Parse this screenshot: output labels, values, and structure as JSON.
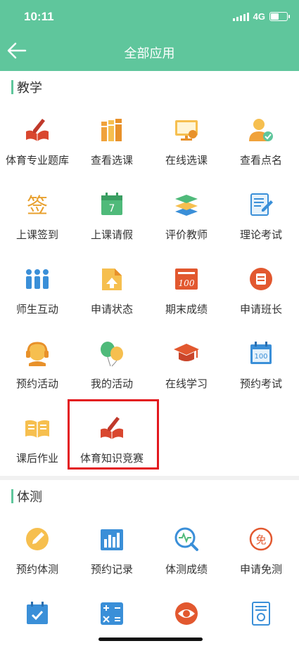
{
  "status": {
    "time": "10:11",
    "network": "4G"
  },
  "header": {
    "title": "全部应用"
  },
  "sections": [
    {
      "name": "教学",
      "items": [
        {
          "label": "体育专业题库",
          "icon": "book-pen-icon"
        },
        {
          "label": "查看选课",
          "icon": "books-icon"
        },
        {
          "label": "在线选课",
          "icon": "screen-icon"
        },
        {
          "label": "查看点名",
          "icon": "user-check-icon"
        },
        {
          "label": "上课签到",
          "icon": "sign-icon"
        },
        {
          "label": "上课请假",
          "icon": "calendar-icon"
        },
        {
          "label": "评价教师",
          "icon": "layers-icon"
        },
        {
          "label": "理论考试",
          "icon": "document-edit-icon"
        },
        {
          "label": "师生互动",
          "icon": "people-icon"
        },
        {
          "label": "申请状态",
          "icon": "folder-upload-icon"
        },
        {
          "label": "期末成绩",
          "icon": "score-paper-icon"
        },
        {
          "label": "申请班长",
          "icon": "circle-list-icon"
        },
        {
          "label": "预约活动",
          "icon": "headset-icon"
        },
        {
          "label": "我的活动",
          "icon": "balloons-icon"
        },
        {
          "label": "在线学习",
          "icon": "graduation-cap-icon"
        },
        {
          "label": "预约考试",
          "icon": "calendar-100-icon"
        },
        {
          "label": "课后作业",
          "icon": "open-book-icon"
        },
        {
          "label": "体育知识竞赛",
          "icon": "book-pen-icon"
        }
      ]
    },
    {
      "name": "体测",
      "items": [
        {
          "label": "预约体测",
          "icon": "circle-pen-icon"
        },
        {
          "label": "预约记录",
          "icon": "bar-chart-icon"
        },
        {
          "label": "体测成绩",
          "icon": "heartbeat-search-icon"
        },
        {
          "label": "申请免测",
          "icon": "exempt-icon"
        },
        {
          "label": "",
          "icon": "calendar-check-icon"
        },
        {
          "label": "",
          "icon": "calculator-icon"
        },
        {
          "label": "",
          "icon": "eye-icon"
        },
        {
          "label": "",
          "icon": "certificate-icon"
        }
      ]
    }
  ],
  "colors": {
    "accent": "#5fc69c",
    "highlight": "#e3191f"
  }
}
